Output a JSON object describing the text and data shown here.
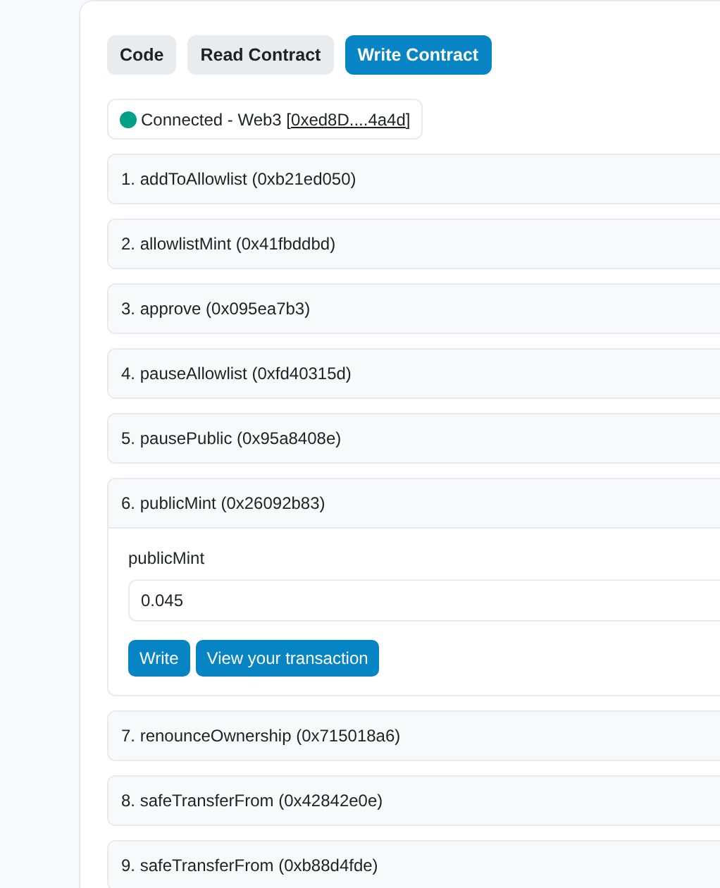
{
  "tabs": [
    {
      "label": "Code",
      "selected": false
    },
    {
      "label": "Read Contract",
      "selected": false
    },
    {
      "label": "Write Contract",
      "selected": true
    }
  ],
  "connection": {
    "connected": true,
    "prefix": "Connected - Web3 [",
    "address": "0xed8D....4a4d",
    "suffix": "]"
  },
  "functions": [
    {
      "title": "1. addToAllowlist (0xb21ed050)",
      "expanded": false
    },
    {
      "title": "2. allowlistMint (0x41fbddbd)",
      "expanded": false
    },
    {
      "title": "3. approve (0x095ea7b3)",
      "expanded": false
    },
    {
      "title": "4. pauseAllowlist (0xfd40315d)",
      "expanded": false
    },
    {
      "title": "5. pausePublic (0x95a8408e)",
      "expanded": false
    },
    {
      "title": "6. publicMint (0x26092b83)",
      "expanded": true,
      "input_label": "publicMint",
      "input_value": "0.045",
      "buttons": [
        "Write",
        "View your transaction"
      ]
    },
    {
      "title": "7. renounceOwnership (0x715018a6)",
      "expanded": false
    },
    {
      "title": "8. safeTransferFrom (0x42842e0e)",
      "expanded": false
    },
    {
      "title": "9. safeTransferFrom (0xb88d4fde)",
      "expanded": false
    }
  ]
}
